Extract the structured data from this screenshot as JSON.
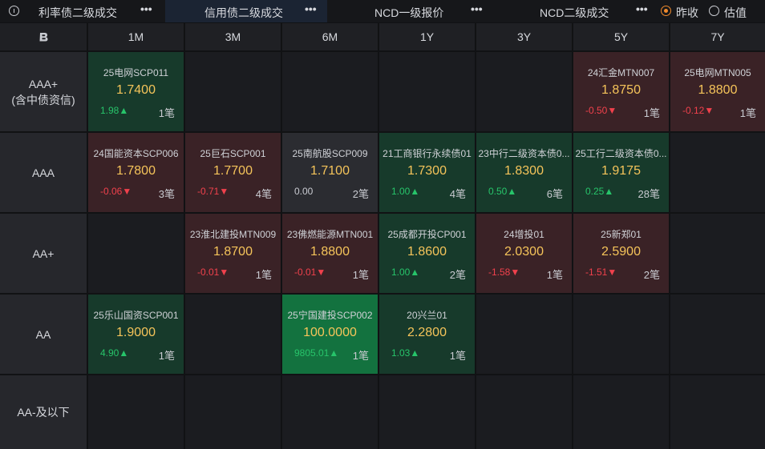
{
  "tabs": [
    {
      "label": "利率债二级成交",
      "more": "•••"
    },
    {
      "label": "信用债二级成交",
      "more": "•••",
      "active": true
    },
    {
      "label": "NCD一级报价",
      "more": "•••"
    },
    {
      "label": "NCD二级成交",
      "more": "•••"
    }
  ],
  "mode_options": [
    {
      "label": "昨收",
      "selected": true
    },
    {
      "label": "估值",
      "selected": false
    }
  ],
  "corner_icon": "B",
  "columns": [
    "1M",
    "3M",
    "6M",
    "1Y",
    "3Y",
    "5Y",
    "7Y"
  ],
  "rows": [
    {
      "label": "AAA+",
      "sublabel": "(含中债资信)"
    },
    {
      "label": "AAA",
      "sublabel": ""
    },
    {
      "label": "AA+",
      "sublabel": ""
    },
    {
      "label": "AA",
      "sublabel": ""
    },
    {
      "label": "AA-及以下",
      "sublabel": ""
    }
  ],
  "cells": [
    [
      {
        "name": "25电网SCP011",
        "yield": "1.7400",
        "change": "1.98▲",
        "direction": "up",
        "count": "1笔",
        "tone": "green"
      },
      null,
      null,
      null,
      null,
      {
        "name": "24汇金MTN007",
        "yield": "1.8750",
        "change": "-0.50▼",
        "direction": "down",
        "count": "1笔",
        "tone": "red"
      },
      {
        "name": "25电网MTN005",
        "yield": "1.8800",
        "change": "-0.12▼",
        "direction": "down",
        "count": "1笔",
        "tone": "red"
      }
    ],
    [
      {
        "name": "24国能资本SCP006",
        "yield": "1.7800",
        "change": "-0.06▼",
        "direction": "down",
        "count": "3笔",
        "tone": "red"
      },
      {
        "name": "25巨石SCP001",
        "yield": "1.7700",
        "change": "-0.71▼",
        "direction": "down",
        "count": "4笔",
        "tone": "red"
      },
      {
        "name": "25南航股SCP009",
        "yield": "1.7100",
        "change": "0.00",
        "direction": "flat",
        "count": "2笔",
        "tone": "neutral"
      },
      {
        "name": "21工商银行永续债01",
        "yield": "1.7300",
        "change": "1.00▲",
        "direction": "up",
        "count": "4笔",
        "tone": "green"
      },
      {
        "name": "23中行二级资本债0...",
        "yield": "1.8300",
        "change": "0.50▲",
        "direction": "up",
        "count": "6笔",
        "tone": "green"
      },
      {
        "name": "25工行二级资本债0...",
        "yield": "1.9175",
        "change": "0.25▲",
        "direction": "up",
        "count": "28笔",
        "tone": "green"
      },
      null
    ],
    [
      null,
      {
        "name": "23淮北建投MTN009",
        "yield": "1.8700",
        "change": "-0.01▼",
        "direction": "down",
        "count": "1笔",
        "tone": "red"
      },
      {
        "name": "23佛燃能源MTN001",
        "yield": "1.8800",
        "change": "-0.01▼",
        "direction": "down",
        "count": "1笔",
        "tone": "red"
      },
      {
        "name": "25成都开投CP001",
        "yield": "1.8600",
        "change": "1.00▲",
        "direction": "up",
        "count": "2笔",
        "tone": "green"
      },
      {
        "name": "24增投01",
        "yield": "2.0300",
        "change": "-1.58▼",
        "direction": "down",
        "count": "1笔",
        "tone": "red"
      },
      {
        "name": "25新郑01",
        "yield": "2.5900",
        "change": "-1.51▼",
        "direction": "down",
        "count": "2笔",
        "tone": "red"
      },
      null
    ],
    [
      {
        "name": "25乐山国资SCP001",
        "yield": "1.9000",
        "change": "4.90▲",
        "direction": "up",
        "count": "1笔",
        "tone": "green"
      },
      null,
      {
        "name": "25宁国建投SCP002",
        "yield": "100.0000",
        "change": "9805.01▲",
        "direction": "up",
        "count": "1笔",
        "tone": "bright"
      },
      {
        "name": "20兴兰01",
        "yield": "2.2800",
        "change": "1.03▲",
        "direction": "up",
        "count": "1笔",
        "tone": "green"
      },
      null,
      null,
      null
    ],
    [
      null,
      null,
      null,
      null,
      null,
      null,
      null
    ]
  ],
  "colors": {
    "background": "#111214",
    "yield": "#f5c45a",
    "up": "#27c46a",
    "down": "#f0414c",
    "accent": "#f08a2c"
  }
}
